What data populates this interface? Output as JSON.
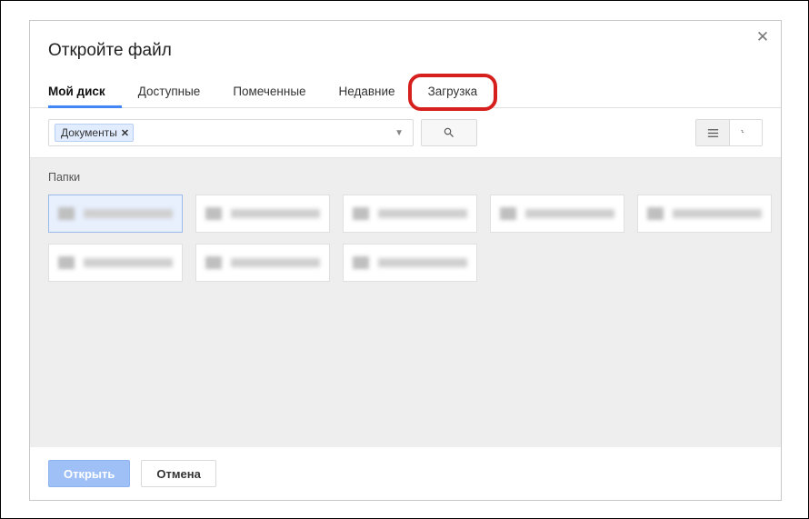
{
  "dialog": {
    "title": "Откройте файл"
  },
  "tabs": [
    {
      "label": "Мой диск",
      "active": true
    },
    {
      "label": "Доступные"
    },
    {
      "label": "Помеченные"
    },
    {
      "label": "Недавние"
    },
    {
      "label": "Загрузка",
      "highlighted": true
    }
  ],
  "breadcrumb": {
    "chip_label": "Документы"
  },
  "section": {
    "folders_label": "Папки"
  },
  "folders": [
    {
      "selected": true
    },
    {},
    {},
    {},
    {},
    {},
    {},
    {}
  ],
  "footer": {
    "open_label": "Открыть",
    "cancel_label": "Отмена"
  }
}
